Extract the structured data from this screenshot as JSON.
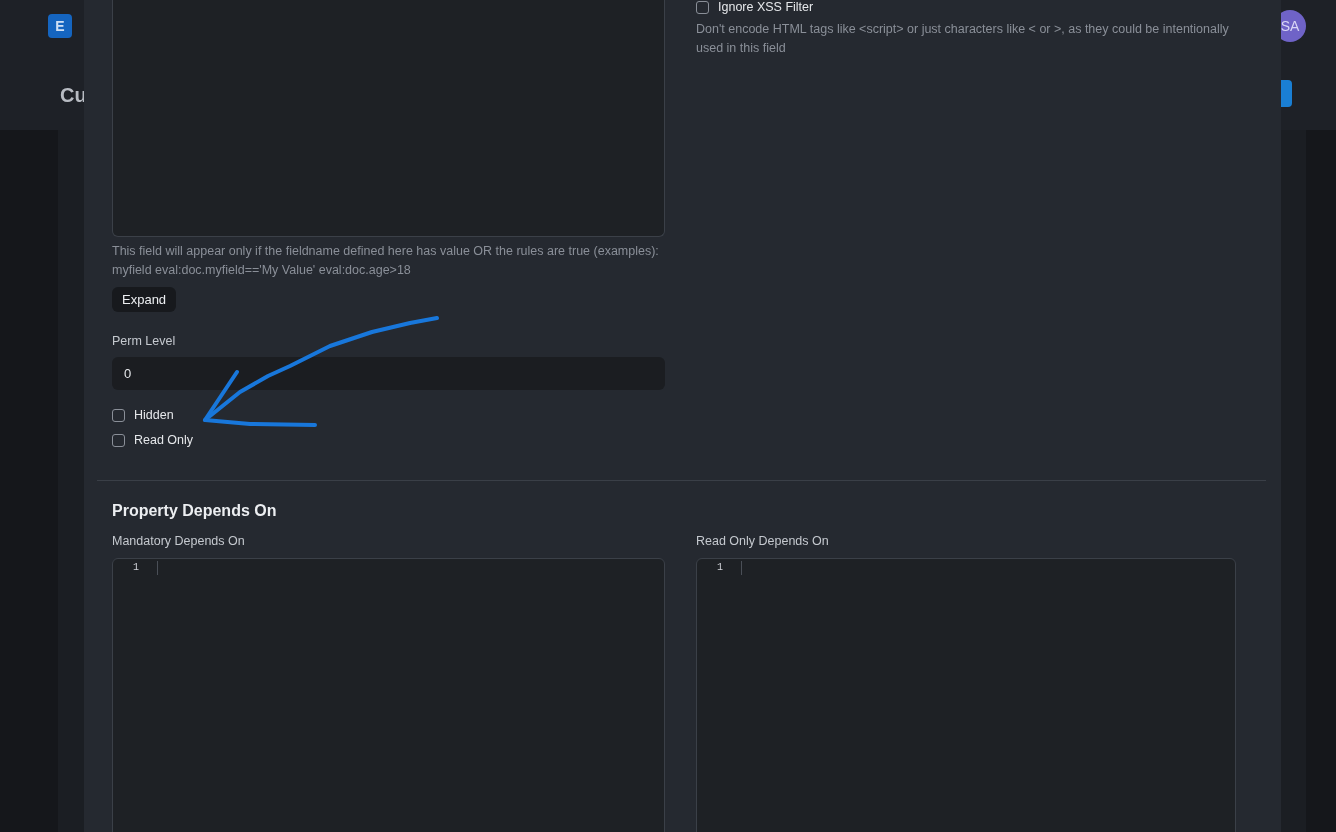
{
  "background_page": {
    "logo": "E",
    "title": "Cu",
    "avatar": "SA"
  },
  "dialog": {
    "left": {
      "description": "This field will appear only if the fieldname defined here has value OR the rules are true (examples): myfield eval:doc.myfield=='My Value' eval:doc.age>18",
      "expand_button": "Expand",
      "perm_level": {
        "label": "Perm Level",
        "value": "0"
      },
      "checkboxes": [
        {
          "label": "Hidden",
          "checked": false
        },
        {
          "label": "Read Only",
          "checked": false
        }
      ]
    },
    "right": {
      "checkbox": {
        "label": "Ignore XSS Filter",
        "checked": false
      },
      "description": "Don't encode HTML tags like <script> or just characters like < or >, as they could be intentionally used in this field"
    },
    "section": {
      "title": "Property Depends On",
      "editors": [
        {
          "label": "Mandatory Depends On",
          "line_numbers": [
            "1"
          ]
        },
        {
          "label": "Read Only Depends On",
          "line_numbers": [
            "1"
          ]
        }
      ]
    }
  }
}
